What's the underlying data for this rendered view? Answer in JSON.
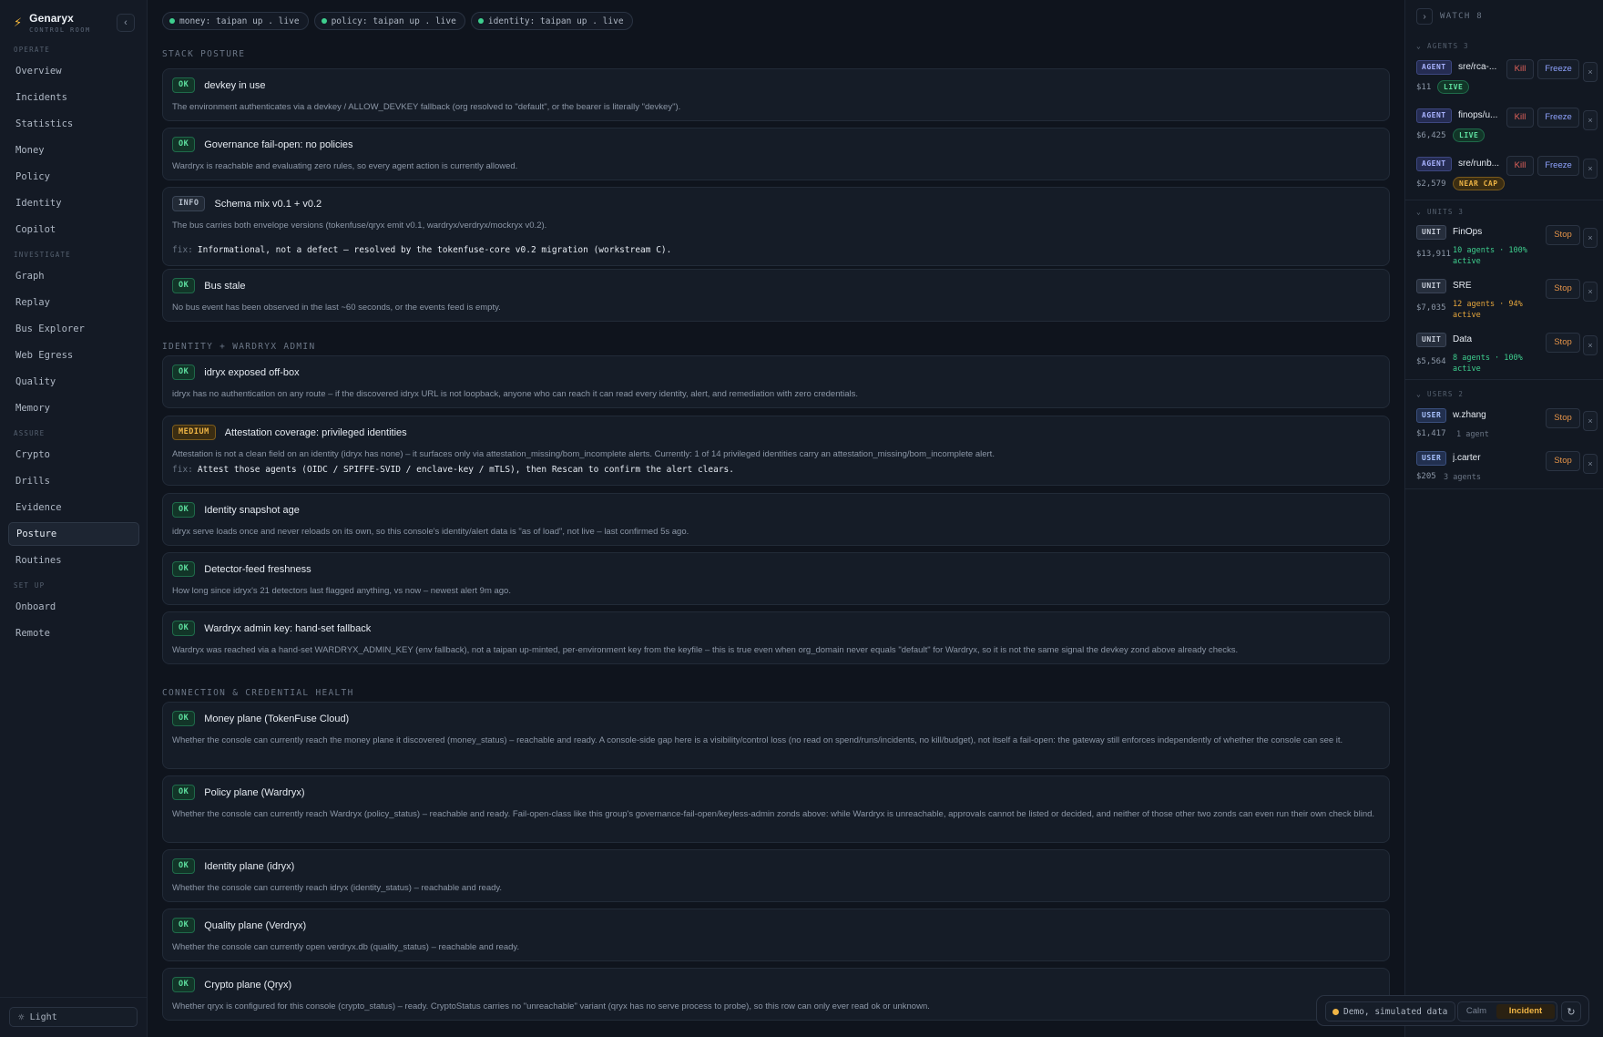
{
  "app": {
    "name": "Genaryx",
    "subtitle": "CONTROL ROOM"
  },
  "sidebar": {
    "sections": [
      {
        "label": "OPERATE",
        "items": [
          "Overview",
          "Incidents",
          "Statistics",
          "Money",
          "Policy",
          "Identity",
          "Copilot"
        ]
      },
      {
        "label": "INVESTIGATE",
        "items": [
          "Graph",
          "Replay",
          "Bus Explorer",
          "Web Egress",
          "Quality",
          "Memory"
        ]
      },
      {
        "label": "ASSURE",
        "items": [
          "Crypto",
          "Drills",
          "Evidence",
          "Posture",
          "Routines"
        ]
      },
      {
        "label": "SET UP",
        "items": [
          "Onboard",
          "Remote"
        ]
      }
    ],
    "active": "Posture",
    "theme_label": "Light"
  },
  "status_pills": [
    {
      "label": "money: taipan up . live",
      "color": "#3ecf8e"
    },
    {
      "label": "policy: taipan up . live",
      "color": "#3ecf8e"
    },
    {
      "label": "identity: taipan up . live",
      "color": "#3ecf8e"
    }
  ],
  "sections": [
    {
      "title": "STACK POSTURE",
      "cards": [
        {
          "badge": "OK",
          "title": "devkey in use",
          "desc": "The environment authenticates via a devkey / ALLOW_DEVKEY fallback (org resolved to \"default\", or the bearer is literally \"devkey\").",
          "fix": ""
        },
        {
          "badge": "OK",
          "title": "Governance fail-open: no policies",
          "desc": "Wardryx is reachable and evaluating zero rules, so every agent action is currently allowed.",
          "fix": ""
        },
        {
          "badge": "INFO",
          "title": "Schema mix v0.1 + v0.2",
          "desc": "The bus carries both envelope versions (tokenfuse/qryx emit v0.1, wardryx/verdryx/mockryx v0.2).",
          "fix": "Informational, not a defect – resolved by the tokenfuse-core v0.2 migration (workstream C)."
        },
        {
          "badge": "OK",
          "title": "Bus stale",
          "desc": "No bus event has been observed in the last ~60 seconds, or the events feed is empty.",
          "fix": ""
        }
      ]
    },
    {
      "title": "IDENTITY + WARDRYX ADMIN",
      "cards": [
        {
          "badge": "OK",
          "title": "idryx exposed off-box",
          "desc": "idryx has no authentication on any route – if the discovered idryx URL is not loopback, anyone who can reach it can read every identity, alert, and remediation with zero credentials.",
          "fix": ""
        },
        {
          "badge": "MEDIUM",
          "title": "Attestation coverage: privileged identities",
          "desc": "Attestation is not a clean field on an identity (idryx has none) – it surfaces only via attestation_missing/bom_incomplete alerts. Currently: 1 of 14 privileged identities carry an attestation_missing/bom_incomplete alert.",
          "fix": "Attest those agents (OIDC / SPIFFE-SVID / enclave-key / mTLS), then Rescan to confirm the alert clears."
        },
        {
          "badge": "OK",
          "title": "Identity snapshot age",
          "desc": "idryx serve loads once and never reloads on its own, so this console's identity/alert data is \"as of load\", not live – last confirmed 5s ago.",
          "fix": ""
        },
        {
          "badge": "OK",
          "title": "Detector-feed freshness",
          "desc": "How long since idryx's 21 detectors last flagged anything, vs now – newest alert 9m ago.",
          "fix": ""
        },
        {
          "badge": "OK",
          "title": "Wardryx admin key: hand-set fallback",
          "desc": "Wardryx was reached via a hand-set WARDRYX_ADMIN_KEY (env fallback), not a taipan up-minted, per-environment key from the keyfile – this is true even when org_domain never equals \"default\" for Wardryx, so it is not the same signal the devkey zond above already checks.",
          "fix": ""
        }
      ]
    },
    {
      "title": "CONNECTION & CREDENTIAL HEALTH",
      "cards": [
        {
          "badge": "OK",
          "title": "Money plane (TokenFuse Cloud)",
          "desc": "Whether the console can currently reach the money plane it discovered (money_status) – reachable and ready. A console-side gap here is a visibility/control loss (no read on spend/runs/incidents, no kill/budget), not itself a fail-open: the gateway still enforces independently of whether the console can see it.",
          "fix": ""
        },
        {
          "badge": "OK",
          "title": "Policy plane (Wardryx)",
          "desc": "Whether the console can currently reach Wardryx (policy_status) – reachable and ready. Fail-open-class like this group's governance-fail-open/keyless-admin zonds above: while Wardryx is unreachable, approvals cannot be listed or decided, and neither of those other two zonds can even run their own check blind.",
          "fix": ""
        },
        {
          "badge": "OK",
          "title": "Identity plane (idryx)",
          "desc": "Whether the console can currently reach idryx (identity_status) – reachable and ready.",
          "fix": ""
        },
        {
          "badge": "OK",
          "title": "Quality plane (Verdryx)",
          "desc": "Whether the console can currently open verdryx.db (quality_status) – reachable and ready.",
          "fix": ""
        },
        {
          "badge": "OK",
          "title": "Crypto plane (Qryx)",
          "desc": "Whether qryx is configured for this console (crypto_status) – ready. CryptoStatus carries no \"unreachable\" variant (qryx has no serve process to probe), so this row can only ever read ok or unknown.",
          "fix": ""
        }
      ]
    }
  ],
  "watch": {
    "label": "WATCH 8",
    "agents_label": "AGENTS 3",
    "units_label": "UNITS 3",
    "users_label": "USERS 2",
    "agents": [
      {
        "kind": "AGENT",
        "name": "sre/rca-...",
        "cost": "$11",
        "state": "LIVE",
        "kill": "Kill",
        "freeze": "Freeze",
        "close": "×"
      },
      {
        "kind": "AGENT",
        "name": "finops/u...",
        "cost": "$6,425",
        "state": "LIVE",
        "kill": "Kill",
        "freeze": "Freeze",
        "close": "×"
      },
      {
        "kind": "AGENT",
        "name": "sre/runb...",
        "cost": "$2,579",
        "state": "NEAR CAP",
        "kill": "Kill",
        "freeze": "Freeze",
        "close": "×"
      }
    ],
    "units": [
      {
        "kind": "UNIT",
        "name": "FinOps",
        "cost": "$13,911",
        "sub": "10 agents · 100% active",
        "tone": "green",
        "stop": "Stop",
        "close": "×"
      },
      {
        "kind": "UNIT",
        "name": "SRE",
        "cost": "$7,035",
        "sub": "12 agents · 94% active",
        "tone": "amber",
        "stop": "Stop",
        "close": "×"
      },
      {
        "kind": "UNIT",
        "name": "Data",
        "cost": "$5,564",
        "sub": "8 agents · 100% active",
        "tone": "green",
        "stop": "Stop",
        "close": "×"
      }
    ],
    "users": [
      {
        "kind": "USER",
        "name": "w.zhang",
        "cost": "$1,417",
        "sub": "1 agent",
        "stop": "Stop",
        "close": "×"
      },
      {
        "kind": "USER",
        "name": "j.carter",
        "cost": "$205",
        "sub": "3 agents",
        "stop": "Stop",
        "close": "×"
      }
    ]
  },
  "demo": {
    "chip": "Demo, simulated data",
    "calm": "Calm",
    "incident": "Incident"
  },
  "colors": {
    "ok": "#5ee0a0",
    "medium": "#f0b545",
    "kill": "#e0615a",
    "freeze": "#8fa3ff",
    "stop": "#e39248",
    "brand": "#f5b73b"
  }
}
